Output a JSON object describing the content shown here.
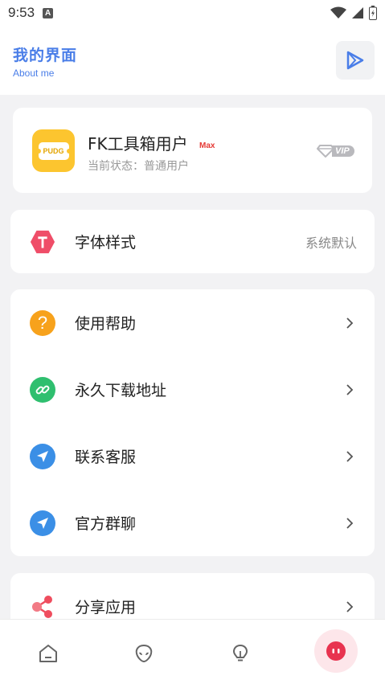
{
  "status_bar": {
    "time": "9:53",
    "notification_letter": "A"
  },
  "header": {
    "title": "我的界面",
    "subtitle": "About me",
    "action_icon": "play-icon"
  },
  "profile": {
    "avatar_text": "PUDG",
    "name": "FK工具箱用户",
    "tag": "Max",
    "status": "当前状态：普通用户",
    "badge": "VIP"
  },
  "font_setting": {
    "label": "字体样式",
    "value": "系统默认"
  },
  "menu": {
    "items": [
      {
        "label": "使用帮助",
        "icon": "help-icon"
      },
      {
        "label": "永久下载地址",
        "icon": "link-icon"
      },
      {
        "label": "联系客服",
        "icon": "send-icon"
      },
      {
        "label": "官方群聊",
        "icon": "send-icon"
      }
    ]
  },
  "share": {
    "label": "分享应用",
    "icon": "share-icon"
  },
  "colors": {
    "accent": "#4a7ee8",
    "active_nav": "#e8334f",
    "avatar": "#fcc52f"
  }
}
